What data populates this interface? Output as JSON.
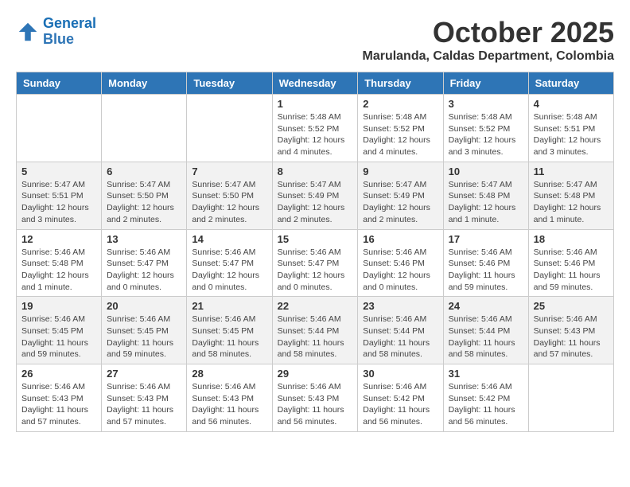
{
  "logo": {
    "line1": "General",
    "line2": "Blue"
  },
  "title": "October 2025",
  "subtitle": "Marulanda, Caldas Department, Colombia",
  "days_header": [
    "Sunday",
    "Monday",
    "Tuesday",
    "Wednesday",
    "Thursday",
    "Friday",
    "Saturday"
  ],
  "weeks": [
    [
      {
        "day": "",
        "info": ""
      },
      {
        "day": "",
        "info": ""
      },
      {
        "day": "",
        "info": ""
      },
      {
        "day": "1",
        "info": "Sunrise: 5:48 AM\nSunset: 5:52 PM\nDaylight: 12 hours\nand 4 minutes."
      },
      {
        "day": "2",
        "info": "Sunrise: 5:48 AM\nSunset: 5:52 PM\nDaylight: 12 hours\nand 4 minutes."
      },
      {
        "day": "3",
        "info": "Sunrise: 5:48 AM\nSunset: 5:52 PM\nDaylight: 12 hours\nand 3 minutes."
      },
      {
        "day": "4",
        "info": "Sunrise: 5:48 AM\nSunset: 5:51 PM\nDaylight: 12 hours\nand 3 minutes."
      }
    ],
    [
      {
        "day": "5",
        "info": "Sunrise: 5:47 AM\nSunset: 5:51 PM\nDaylight: 12 hours\nand 3 minutes."
      },
      {
        "day": "6",
        "info": "Sunrise: 5:47 AM\nSunset: 5:50 PM\nDaylight: 12 hours\nand 2 minutes."
      },
      {
        "day": "7",
        "info": "Sunrise: 5:47 AM\nSunset: 5:50 PM\nDaylight: 12 hours\nand 2 minutes."
      },
      {
        "day": "8",
        "info": "Sunrise: 5:47 AM\nSunset: 5:49 PM\nDaylight: 12 hours\nand 2 minutes."
      },
      {
        "day": "9",
        "info": "Sunrise: 5:47 AM\nSunset: 5:49 PM\nDaylight: 12 hours\nand 2 minutes."
      },
      {
        "day": "10",
        "info": "Sunrise: 5:47 AM\nSunset: 5:48 PM\nDaylight: 12 hours\nand 1 minute."
      },
      {
        "day": "11",
        "info": "Sunrise: 5:47 AM\nSunset: 5:48 PM\nDaylight: 12 hours\nand 1 minute."
      }
    ],
    [
      {
        "day": "12",
        "info": "Sunrise: 5:46 AM\nSunset: 5:48 PM\nDaylight: 12 hours\nand 1 minute."
      },
      {
        "day": "13",
        "info": "Sunrise: 5:46 AM\nSunset: 5:47 PM\nDaylight: 12 hours\nand 0 minutes."
      },
      {
        "day": "14",
        "info": "Sunrise: 5:46 AM\nSunset: 5:47 PM\nDaylight: 12 hours\nand 0 minutes."
      },
      {
        "day": "15",
        "info": "Sunrise: 5:46 AM\nSunset: 5:47 PM\nDaylight: 12 hours\nand 0 minutes."
      },
      {
        "day": "16",
        "info": "Sunrise: 5:46 AM\nSunset: 5:46 PM\nDaylight: 12 hours\nand 0 minutes."
      },
      {
        "day": "17",
        "info": "Sunrise: 5:46 AM\nSunset: 5:46 PM\nDaylight: 11 hours\nand 59 minutes."
      },
      {
        "day": "18",
        "info": "Sunrise: 5:46 AM\nSunset: 5:46 PM\nDaylight: 11 hours\nand 59 minutes."
      }
    ],
    [
      {
        "day": "19",
        "info": "Sunrise: 5:46 AM\nSunset: 5:45 PM\nDaylight: 11 hours\nand 59 minutes."
      },
      {
        "day": "20",
        "info": "Sunrise: 5:46 AM\nSunset: 5:45 PM\nDaylight: 11 hours\nand 59 minutes."
      },
      {
        "day": "21",
        "info": "Sunrise: 5:46 AM\nSunset: 5:45 PM\nDaylight: 11 hours\nand 58 minutes."
      },
      {
        "day": "22",
        "info": "Sunrise: 5:46 AM\nSunset: 5:44 PM\nDaylight: 11 hours\nand 58 minutes."
      },
      {
        "day": "23",
        "info": "Sunrise: 5:46 AM\nSunset: 5:44 PM\nDaylight: 11 hours\nand 58 minutes."
      },
      {
        "day": "24",
        "info": "Sunrise: 5:46 AM\nSunset: 5:44 PM\nDaylight: 11 hours\nand 58 minutes."
      },
      {
        "day": "25",
        "info": "Sunrise: 5:46 AM\nSunset: 5:43 PM\nDaylight: 11 hours\nand 57 minutes."
      }
    ],
    [
      {
        "day": "26",
        "info": "Sunrise: 5:46 AM\nSunset: 5:43 PM\nDaylight: 11 hours\nand 57 minutes."
      },
      {
        "day": "27",
        "info": "Sunrise: 5:46 AM\nSunset: 5:43 PM\nDaylight: 11 hours\nand 57 minutes."
      },
      {
        "day": "28",
        "info": "Sunrise: 5:46 AM\nSunset: 5:43 PM\nDaylight: 11 hours\nand 56 minutes."
      },
      {
        "day": "29",
        "info": "Sunrise: 5:46 AM\nSunset: 5:43 PM\nDaylight: 11 hours\nand 56 minutes."
      },
      {
        "day": "30",
        "info": "Sunrise: 5:46 AM\nSunset: 5:42 PM\nDaylight: 11 hours\nand 56 minutes."
      },
      {
        "day": "31",
        "info": "Sunrise: 5:46 AM\nSunset: 5:42 PM\nDaylight: 11 hours\nand 56 minutes."
      },
      {
        "day": "",
        "info": ""
      }
    ]
  ]
}
